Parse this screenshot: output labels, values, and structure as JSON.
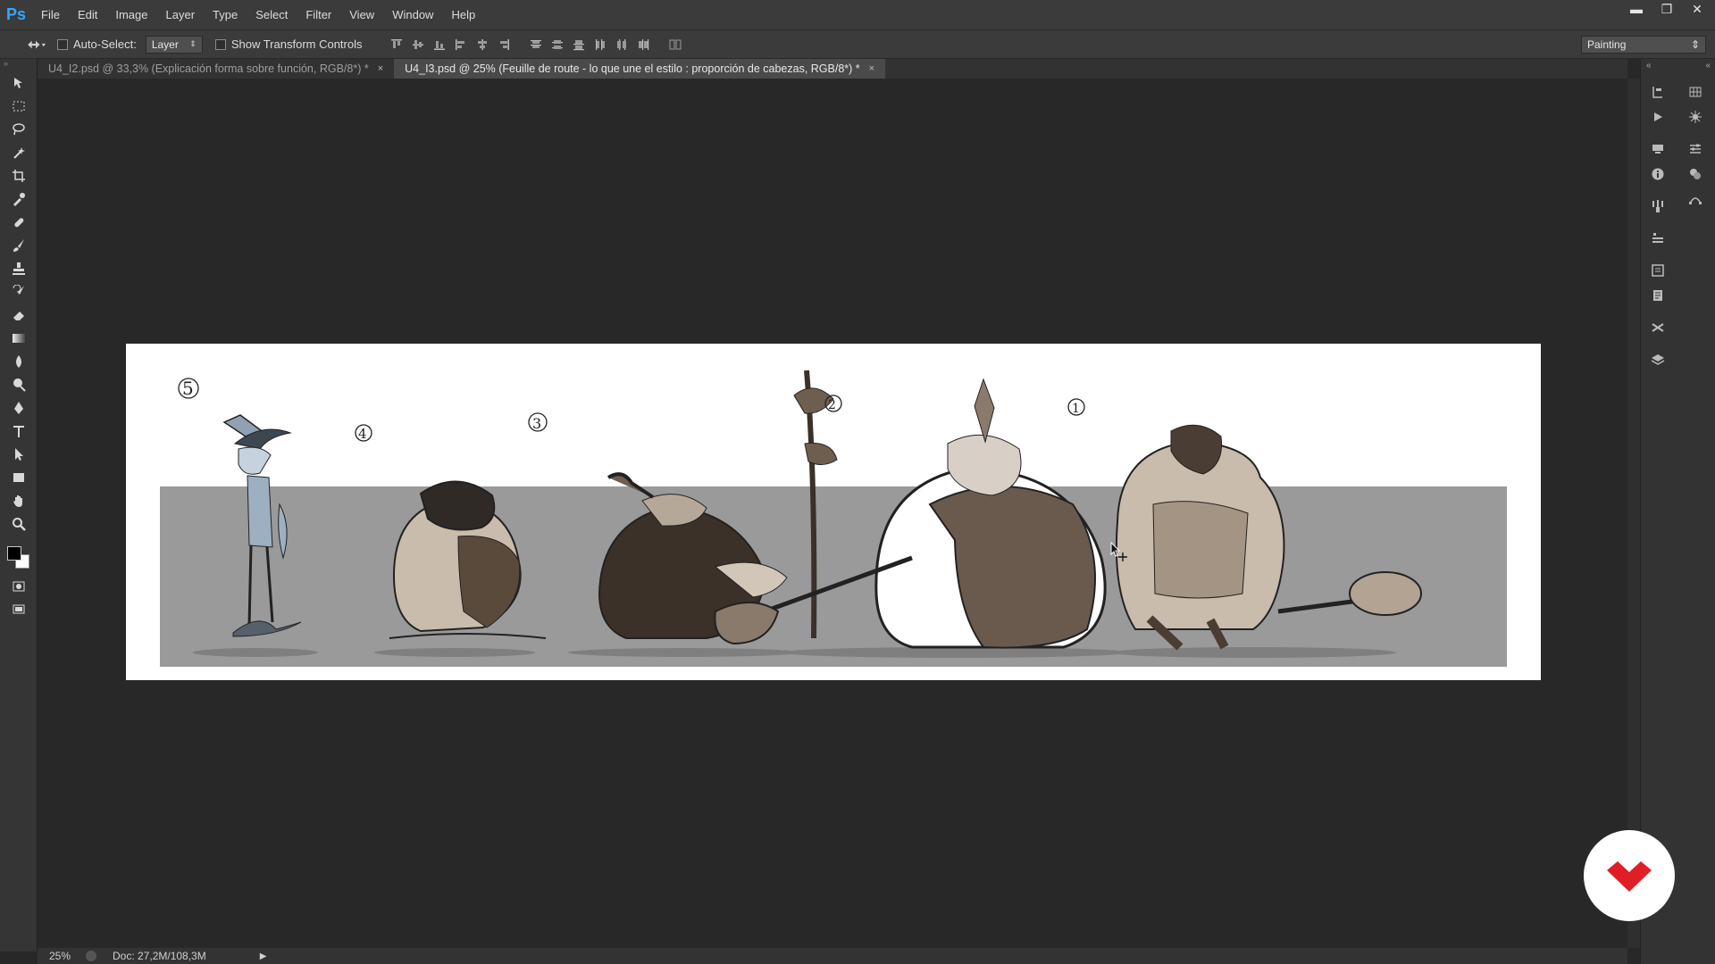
{
  "app": {
    "logo": "Ps"
  },
  "menu": [
    "File",
    "Edit",
    "Image",
    "Layer",
    "Type",
    "Select",
    "Filter",
    "View",
    "Window",
    "Help"
  ],
  "window_controls": {
    "minimize": "▬",
    "maximize": "❐",
    "close": "✕"
  },
  "options": {
    "auto_select_label": "Auto-Select:",
    "auto_select_value": "Layer",
    "show_transform_label": "Show Transform Controls",
    "workspace": "Painting"
  },
  "tabs": [
    {
      "label": "U4_I2.psd @ 33,3% (Explicación forma sobre función, RGB/8*) *",
      "active": false
    },
    {
      "label": "U4_I3.psd @ 25% (Feuille de route - lo que une el estilo : proporción de cabezas, RGB/8*) *",
      "active": true
    }
  ],
  "tab_close": "×",
  "status": {
    "zoom": "25%",
    "doc": "Doc: 27,2M/108,3M"
  },
  "artwork": {
    "numbers": [
      "5",
      "4",
      "3",
      "2",
      "1"
    ]
  },
  "colors": {
    "accent": "#31a8ff",
    "brand_red": "#e01e26",
    "canvas_bg": "#282828"
  }
}
